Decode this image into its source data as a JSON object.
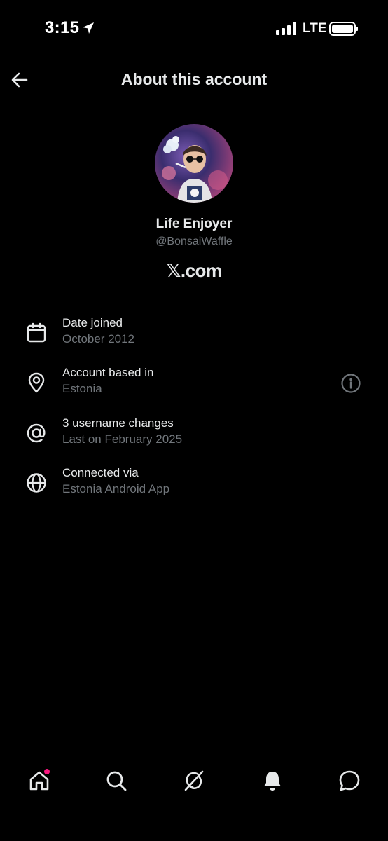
{
  "status_bar": {
    "time": "3:15",
    "network": "LTE"
  },
  "header": {
    "title": "About this account",
    "back_icon": "arrow-left-icon"
  },
  "profile": {
    "display_name": "Life Enjoyer",
    "handle": "@BonsaiWaffle",
    "site_logo_glyph": "𝕏",
    "site_logo_suffix": ".com"
  },
  "info": [
    {
      "icon": "calendar-icon",
      "label": "Date joined",
      "value": "October 2012"
    },
    {
      "icon": "location-pin-icon",
      "label": "Account based in",
      "value": "Estonia",
      "more_icon": "info-circle-icon"
    },
    {
      "icon": "at-sign-icon",
      "label": "3 username changes",
      "value": "Last on February 2025"
    },
    {
      "icon": "globe-icon",
      "label": "Connected via",
      "value": "Estonia Android App"
    }
  ],
  "bottom_nav": [
    {
      "name": "home",
      "icon": "home-icon",
      "has_badge": true
    },
    {
      "name": "search",
      "icon": "search-icon"
    },
    {
      "name": "grok",
      "icon": "grok-icon"
    },
    {
      "name": "notifications",
      "icon": "bell-icon"
    },
    {
      "name": "messages",
      "icon": "message-icon"
    }
  ],
  "colors": {
    "background": "#000000",
    "primary_text": "#e7e9ea",
    "secondary_text": "#71767b",
    "badge": "#f91880"
  }
}
